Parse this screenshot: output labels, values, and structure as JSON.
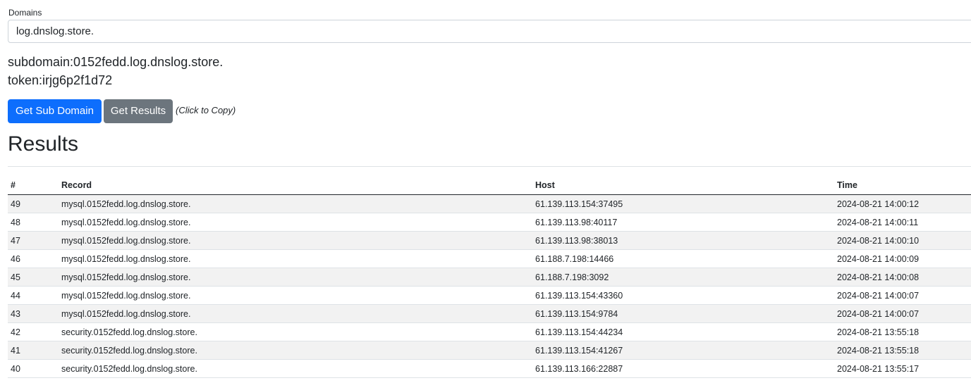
{
  "form": {
    "domains_label": "Domains",
    "selected_domain": "log.dnslog.store."
  },
  "info": {
    "subdomain": "subdomain:0152fedd.log.dnslog.store.",
    "token": "token:irjg6p2f1d72"
  },
  "actions": {
    "get_sub_domain": "Get Sub Domain",
    "get_results": "Get Results",
    "copy_hint": "(Click to Copy)"
  },
  "results": {
    "title": "Results",
    "columns": [
      "#",
      "Record",
      "Host",
      "Time"
    ],
    "rows": [
      [
        "49",
        "mysql.0152fedd.log.dnslog.store.",
        "61.139.113.154:37495",
        "2024-08-21 14:00:12"
      ],
      [
        "48",
        "mysql.0152fedd.log.dnslog.store.",
        "61.139.113.98:40117",
        "2024-08-21 14:00:11"
      ],
      [
        "47",
        "mysql.0152fedd.log.dnslog.store.",
        "61.139.113.98:38013",
        "2024-08-21 14:00:10"
      ],
      [
        "46",
        "mysql.0152fedd.log.dnslog.store.",
        "61.188.7.198:14466",
        "2024-08-21 14:00:09"
      ],
      [
        "45",
        "mysql.0152fedd.log.dnslog.store.",
        "61.188.7.198:3092",
        "2024-08-21 14:00:08"
      ],
      [
        "44",
        "mysql.0152fedd.log.dnslog.store.",
        "61.139.113.154:43360",
        "2024-08-21 14:00:07"
      ],
      [
        "43",
        "mysql.0152fedd.log.dnslog.store.",
        "61.139.113.154:9784",
        "2024-08-21 14:00:07"
      ],
      [
        "42",
        "security.0152fedd.log.dnslog.store.",
        "61.139.113.154:44234",
        "2024-08-21 13:55:18"
      ],
      [
        "41",
        "security.0152fedd.log.dnslog.store.",
        "61.139.113.154:41267",
        "2024-08-21 13:55:18"
      ],
      [
        "40",
        "security.0152fedd.log.dnslog.store.",
        "61.139.113.166:22887",
        "2024-08-21 13:55:17"
      ]
    ]
  }
}
